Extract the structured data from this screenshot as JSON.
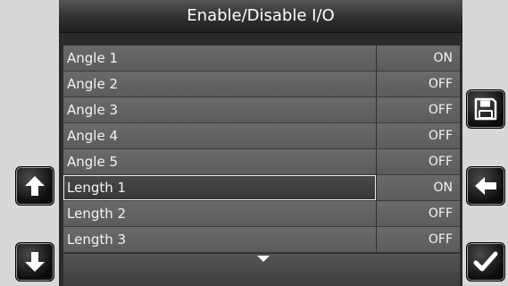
{
  "title": "Enable/Disable I/O",
  "rows": [
    {
      "label": "Angle 1",
      "value": "ON"
    },
    {
      "label": "Angle 2",
      "value": "OFF"
    },
    {
      "label": "Angle 3",
      "value": "OFF"
    },
    {
      "label": "Angle 4",
      "value": "OFF"
    },
    {
      "label": "Angle 5",
      "value": "OFF"
    },
    {
      "label": "Length 1",
      "value": "ON"
    },
    {
      "label": "Length 2",
      "value": "OFF"
    },
    {
      "label": "Length 3",
      "value": "OFF"
    }
  ],
  "selected_index": 5,
  "buttons": {
    "left": [
      "up-arrow-icon",
      "down-arrow-icon"
    ],
    "right": [
      "save-icon",
      "back-arrow-icon",
      "checkmark-icon"
    ]
  },
  "colors": {
    "background": "#d8d8d8",
    "panel": "#2b2b2b",
    "row": "#646464",
    "text": "#f4f4f4"
  }
}
